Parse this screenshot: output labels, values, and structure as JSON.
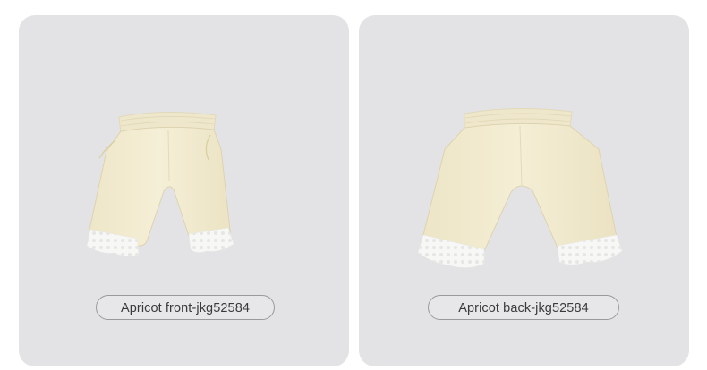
{
  "cards": [
    {
      "caption": "Apricot front-jkg52584",
      "view": "front",
      "colors": {
        "fabric": "#f3ecd2",
        "lace": "#f8f8f6",
        "background": "#e3e3e5"
      }
    },
    {
      "caption": "Apricot back-jkg52584",
      "view": "back",
      "colors": {
        "fabric": "#f3ecd2",
        "lace": "#f8f8f6",
        "background": "#e3e3e5"
      }
    }
  ]
}
